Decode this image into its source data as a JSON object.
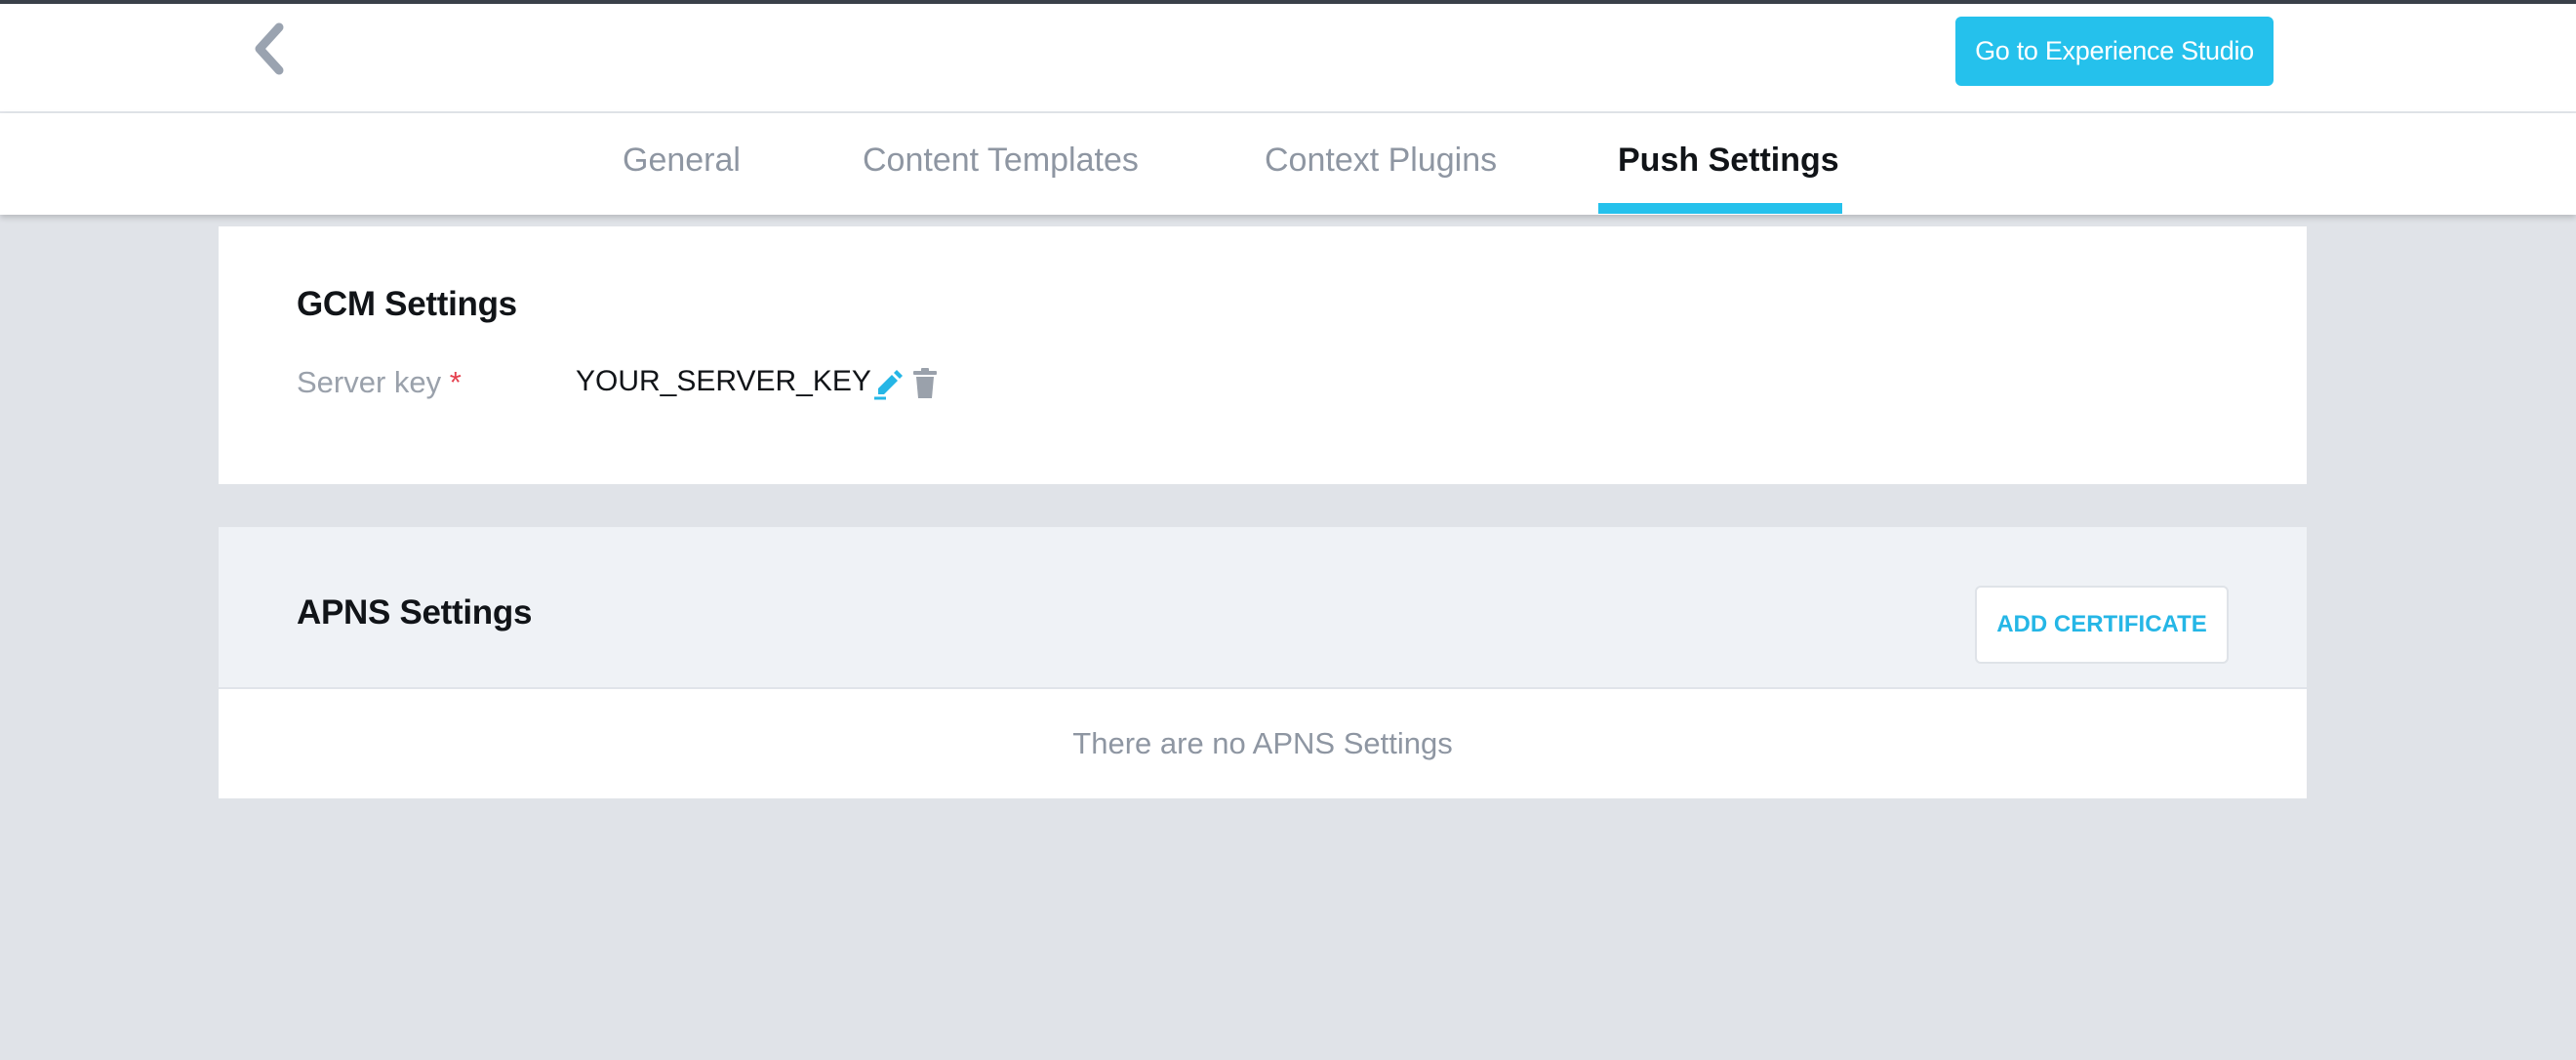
{
  "header": {
    "back_icon": "chevron-left-icon",
    "studio_button_label": "Go to Experience Studio"
  },
  "tabs": [
    {
      "label": "General",
      "active": false
    },
    {
      "label": "Content Templates",
      "active": false
    },
    {
      "label": "Context Plugins",
      "active": false
    },
    {
      "label": "Push Settings",
      "active": true
    }
  ],
  "gcm": {
    "title": "GCM Settings",
    "server_key_label": "Server key",
    "required_marker": "*",
    "server_key_value": "YOUR_SERVER_KEY",
    "edit_icon": "pencil-icon",
    "delete_icon": "trash-icon"
  },
  "apns": {
    "title": "APNS Settings",
    "add_button_label": "ADD CERTIFICATE",
    "empty_message": "There are no APNS Settings"
  },
  "colors": {
    "accent": "#25c1ec",
    "required": "#e5414f",
    "page_background": "#e0e3e8"
  }
}
